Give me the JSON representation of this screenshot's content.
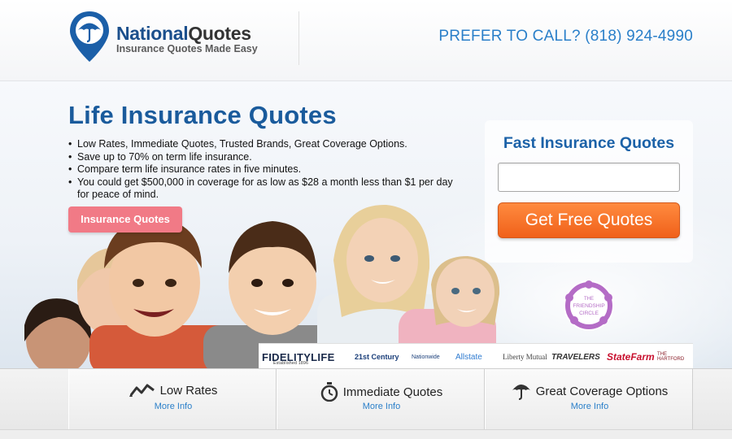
{
  "header": {
    "brand_part1": "National",
    "brand_part2": "Quotes",
    "tagline": "Insurance Quotes Made Easy",
    "phone": "PREFER TO CALL? (818) 924-4990"
  },
  "hero": {
    "title": "Life Insurance Quotes",
    "bullets": [
      "Low Rates, Immediate Quotes, Trusted Brands, Great Coverage Options.",
      "Save up to 70% on term life insurance.",
      "Compare term life insurance rates in five minutes.",
      "You could get $500,000 in coverage for as low as $28 a month less than $1 per day for peace of mind."
    ],
    "cta_label": "Insurance Quotes"
  },
  "quote_form": {
    "title": "Fast Insurance Quotes",
    "input_value": "",
    "button_label": "Get Free Quotes"
  },
  "badge": {
    "line1": "THE",
    "line2": "FRIENDSHIP",
    "line3": "CIRCLE"
  },
  "brands": {
    "fidelity": "FIDELITYLIFE",
    "fidelity_sub": "Established 1896",
    "century": "21st Century",
    "nationwide": "Nationwide",
    "allstate": "Allstate",
    "liberty": "Liberty Mutual",
    "travelers": "TRAVELERS",
    "statefarm": "StateFarm",
    "hartford": "THE HARTFORD"
  },
  "features": [
    {
      "label": "Low Rates",
      "link": "More Info",
      "icon": "trend-line-icon"
    },
    {
      "label": "Immediate Quotes",
      "link": "More Info",
      "icon": "stopwatch-icon"
    },
    {
      "label": "Great Coverage Options",
      "link": "More Info",
      "icon": "umbrella-icon"
    }
  ],
  "colors": {
    "brand_blue": "#1b4f8c",
    "title_blue": "#1a5b9c",
    "phone_blue": "#2a7fc9",
    "cta_pink": "#f17a86",
    "cta_orange": "#f0611a"
  }
}
